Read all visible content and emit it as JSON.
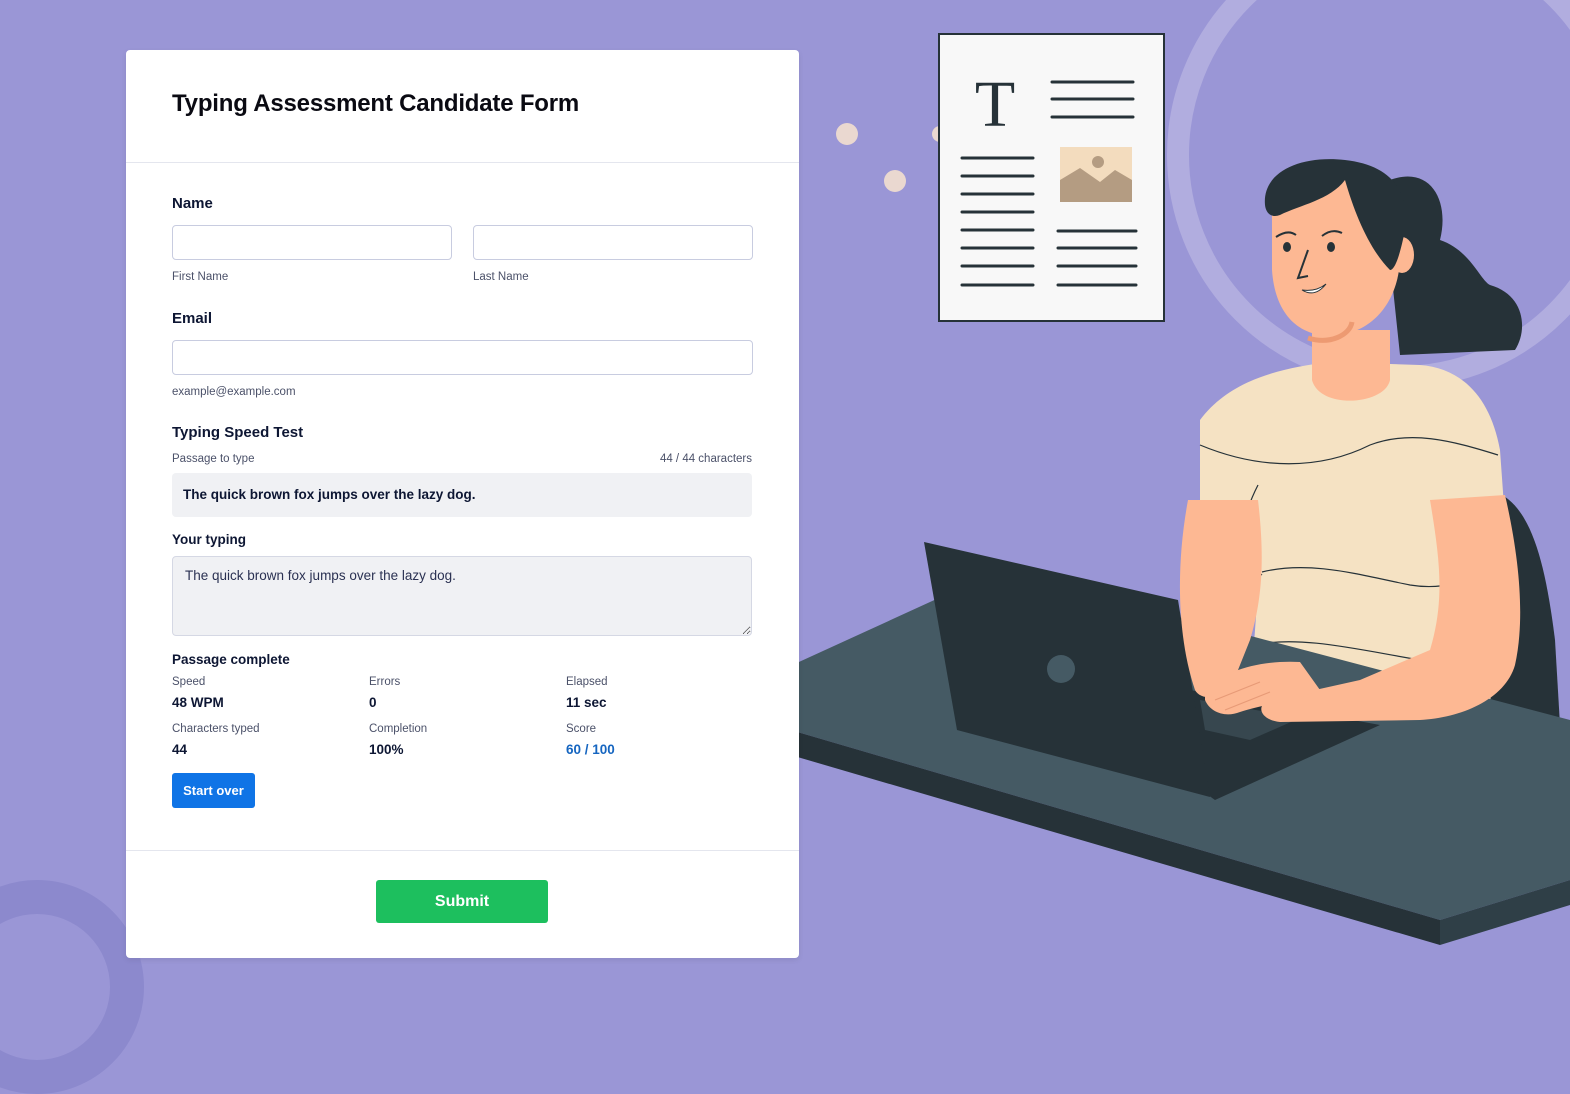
{
  "form": {
    "title": "Typing Assessment Candidate Form",
    "name": {
      "label": "Name",
      "first_value": "",
      "first_sublabel": "First Name",
      "last_value": "",
      "last_sublabel": "Last Name"
    },
    "email": {
      "label": "Email",
      "value": "",
      "sublabel": "example@example.com"
    },
    "typing_test": {
      "label": "Typing Speed Test",
      "passage_label": "Passage to type",
      "char_count": "44 / 44 characters",
      "passage": "The quick brown fox jumps over the lazy dog.",
      "typing_label": "Your typing",
      "typing_value": "The quick brown fox jumps over the lazy dog.",
      "status": "Passage complete",
      "stats": {
        "speed_label": "Speed",
        "speed_value": "48 WPM",
        "errors_label": "Errors",
        "errors_value": "0",
        "elapsed_label": "Elapsed",
        "elapsed_value": "11 sec",
        "chars_label": "Characters typed",
        "chars_value": "44",
        "completion_label": "Completion",
        "completion_value": "100%",
        "score_label": "Score",
        "score_value": "60 / 100"
      },
      "start_over_label": "Start over"
    },
    "submit_label": "Submit"
  },
  "illustration": {
    "document_letter": "T"
  },
  "colors": {
    "background": "#9a96d6",
    "primary_button": "#0f74e6",
    "submit_button": "#1dbf5e",
    "score_accent": "#1565c0"
  }
}
